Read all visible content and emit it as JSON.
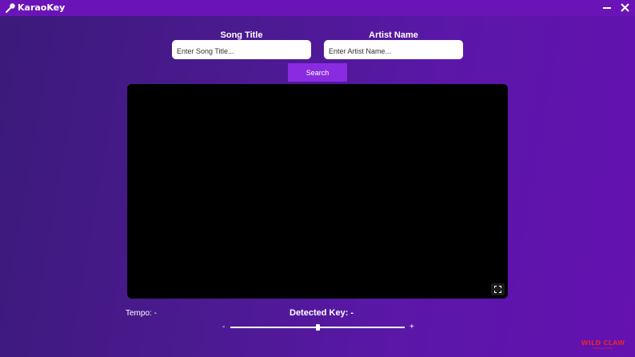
{
  "window": {
    "title": "KaraoKey",
    "icon": "microphone-icon",
    "controls": [
      "minimize-icon",
      "close-icon"
    ]
  },
  "search": {
    "song_label": "Song Title",
    "song_placeholder": "Enter Song Title...",
    "artist_label": "Artist Name",
    "artist_placeholder": "Enter Artist Name...",
    "button_label": "Search"
  },
  "player": {
    "fullscreen_icon": "fullscreen-icon"
  },
  "status": {
    "tempo": "Tempo: -",
    "detected_key": "Detected Key: -"
  },
  "pitch": {
    "minus_label": "-",
    "plus_label": "+",
    "value_fraction": 0.5
  },
  "watermark": {
    "main": "WILD CLAW",
    "sub": "INNOVATIONS",
    "color": "#e0262f"
  },
  "colors": {
    "titlebar": "#6a14b8",
    "accent": "#8a2be2",
    "background_start": "#3b1a7a",
    "background_end": "#6411b0"
  }
}
